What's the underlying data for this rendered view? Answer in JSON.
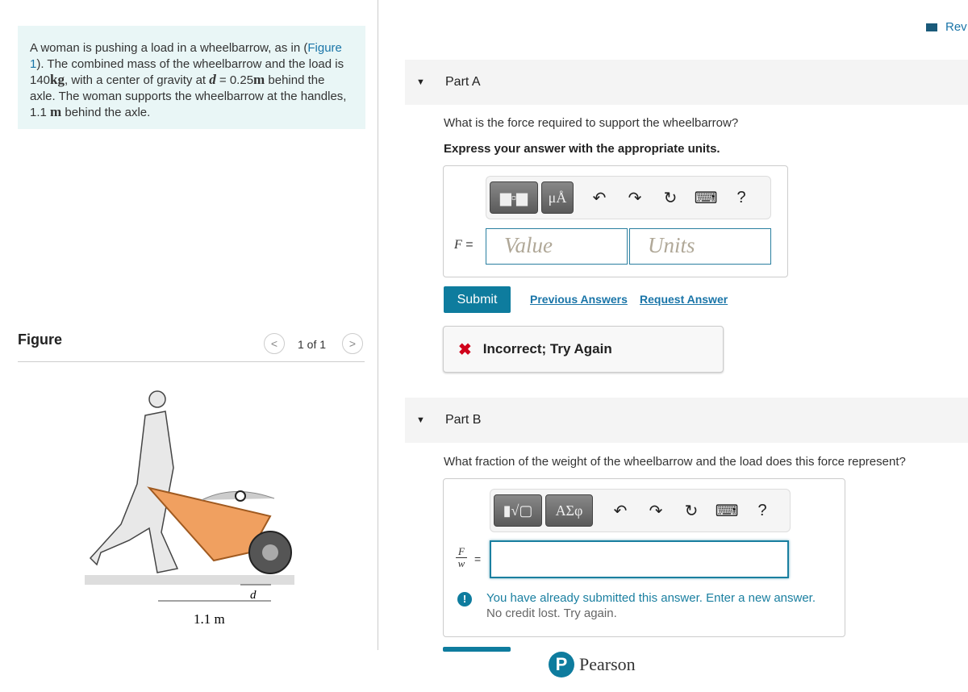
{
  "problem": {
    "text1": "A woman is pushing a load in a wheelbarrow, as in (",
    "figure_link": "Figure 1",
    "text2": "). The combined mass of the wheelbarrow and the load is 140",
    "mass_unit": "kg",
    "text3": ", with a center of gravity at ",
    "d_var": "d",
    "text4": " = 0.25",
    "d_unit": "m",
    "text5": " behind the axle. The woman supports the wheelbarrow at the handles, 1.1 ",
    "h_unit": "m",
    "text6": " behind the axle."
  },
  "figure": {
    "title": "Figure",
    "pager": "1 of 1",
    "prev": "<",
    "next": ">",
    "label_d": "d",
    "label_len": "1.1 m"
  },
  "header": {
    "review": "Rev"
  },
  "partA": {
    "label": "Part A",
    "question": "What is the force required to support the wheelbarrow?",
    "instruction": "Express your answer with the appropriate units.",
    "toolbar_units": "μÅ",
    "help": "?",
    "var": "F",
    "eq": "=",
    "value_placeholder": "Value",
    "units_placeholder": "Units",
    "submit": "Submit",
    "previous_answers": "Previous Answers",
    "request_answer": "Request Answer",
    "feedback": "Incorrect; Try Again",
    "feedback_color": "#d0021b"
  },
  "partB": {
    "label": "Part B",
    "question": "What fraction of the weight of the wheelbarrow and the load does this force represent?",
    "toolbar_greek": "ΑΣφ",
    "help": "?",
    "num": "F",
    "den": "w",
    "eq": "=",
    "value": "",
    "warning_line1": "You have already submitted this answer. Enter a new answer.",
    "warning_line2": "No credit lost. Try again."
  },
  "footer": {
    "brand": "Pearson",
    "accent": "#0e7c9e"
  }
}
